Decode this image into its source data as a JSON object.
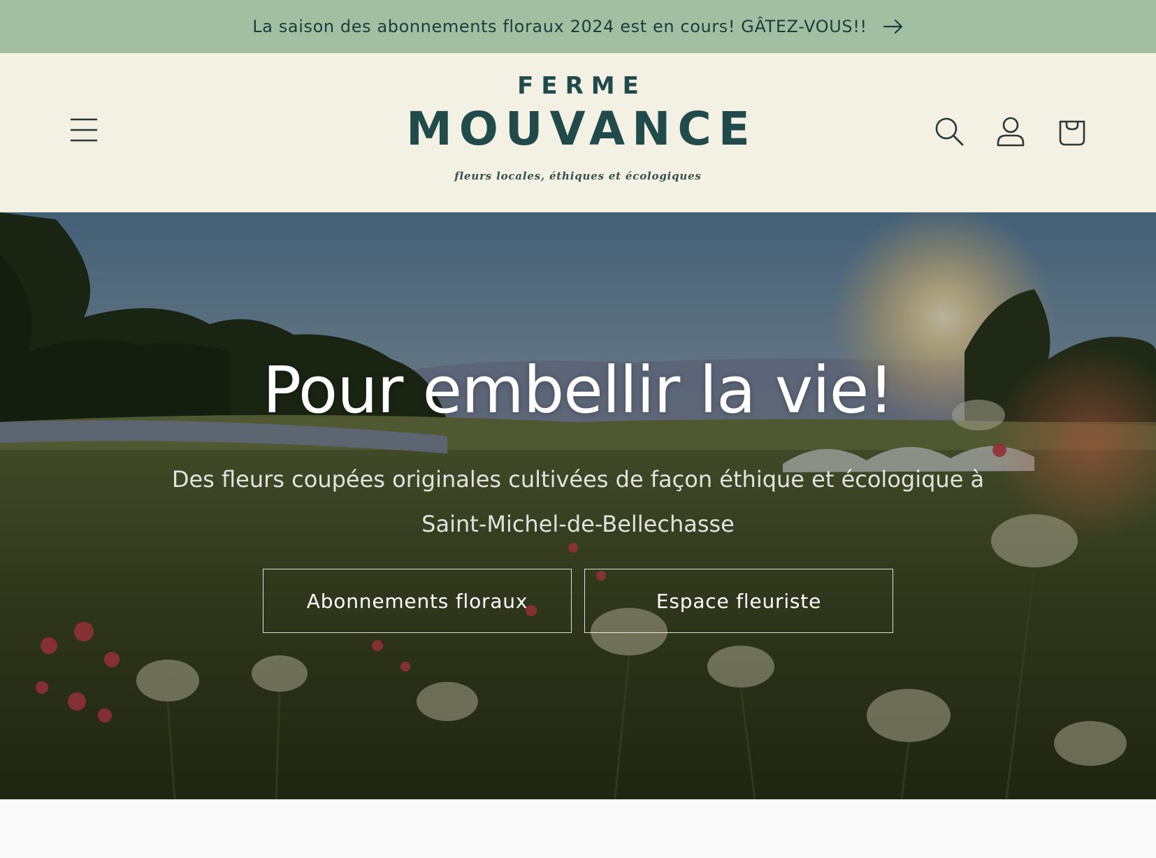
{
  "announcement": {
    "text": "La saison des abonnements floraux 2024 est en cours! GÂTEZ-VOUS!!",
    "icon": "arrow-right-icon",
    "background": "#a3bfa1"
  },
  "header": {
    "background": "#f3f0e4",
    "logo": {
      "top": "FERME",
      "main": "MOUVANCE",
      "tagline": "fleurs locales, éthiques et écologiques",
      "color": "#214b4a"
    },
    "icons": {
      "menu": "hamburger-menu-icon",
      "search": "search-icon",
      "account": "account-icon",
      "cart": "cart-icon"
    }
  },
  "hero": {
    "title": "Pour embellir la vie!",
    "subtitle": "Des fleurs coupées originales cultivées de façon éthique et écologique à Saint-Michel-de-Bellechasse",
    "buttons": [
      {
        "label": "Abonnements floraux"
      },
      {
        "label": "Espace fleuriste"
      }
    ]
  }
}
